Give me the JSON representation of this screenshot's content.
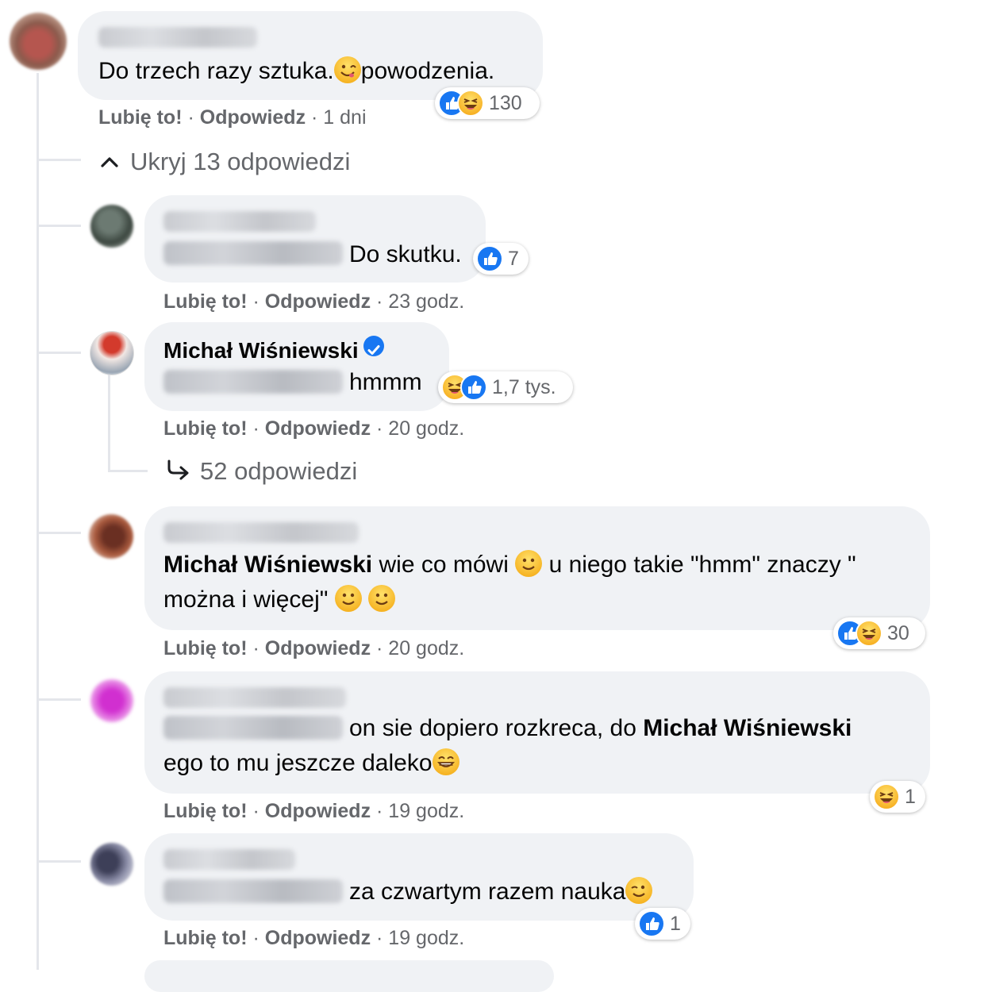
{
  "colors": {
    "link_blue": "#1877f2",
    "bubble_bg": "#f0f2f5",
    "meta_gray": "#65676b",
    "text": "#050505"
  },
  "comment_top": {
    "author": "Teresa Śpinak",
    "text": "Do trzech razy sztuka.",
    "emoji_1": "yum-emoji",
    "text_2": "powodzenia.",
    "like_label": "Lubię to!",
    "reply_label": "Odpowiedz",
    "time": "1 dni",
    "reactions": {
      "icons": [
        "like-icon",
        "haha-icon"
      ],
      "count": "130"
    }
  },
  "hide_replies": {
    "icon": "chevron-up-icon",
    "label": "Ukryj 13 odpowiedzi"
  },
  "replies": [
    {
      "author": "Alicja Lisowska",
      "mention": "Teresa Śpinak",
      "text": "Do skutku.",
      "like_label": "Lubię to!",
      "reply_label": "Odpowiedz",
      "time": "23 godz.",
      "reactions": {
        "icons": [
          "like-icon"
        ],
        "count": "7"
      }
    },
    {
      "author": "Michał Wiśniewski",
      "verified": true,
      "mention": "Teresa Śpinak",
      "text": "hmmm",
      "like_label": "Lubię to!",
      "reply_label": "Odpowiedz",
      "time": "20 godz.",
      "reactions": {
        "icons": [
          "haha-icon",
          "like-icon"
        ],
        "count": "1,7 tys."
      },
      "sub_replies": {
        "icon": "reply-arrow-icon",
        "label": "52 odpowiedzi"
      }
    },
    {
      "author": "Kamil Chmielewski",
      "mention_bold": "Michał Wiśniewski",
      "line1": "wie co mówi",
      "line1b": "u niego takie \"hmm\" znaczy \"",
      "line2": "można i więcej\"",
      "like_label": "Lubię to!",
      "reply_label": "Odpowiedz",
      "time": "20 godz.",
      "reactions": {
        "icons": [
          "like-icon",
          "haha-icon"
        ],
        "count": "30"
      }
    },
    {
      "author": "Patrycja Kowalczyk",
      "mention": "Teresa Śpinak",
      "line1": "on sie dopiero rozkreca, do",
      "mention_bold": "Michał Wiśniewski",
      "line2": "ego to mu jeszcze daleko",
      "like_label": "Lubię to!",
      "reply_label": "Odpowiedz",
      "time": "19 godz.",
      "reactions": {
        "icons": [
          "haha-icon"
        ],
        "count": "1"
      }
    },
    {
      "author": "Aneta Aneta",
      "mention": "Teresa Śpinak",
      "text": "za czwartym razem nauka",
      "like_label": "Lubię to!",
      "reply_label": "Odpowiedz",
      "time": "19 godz.",
      "reactions": {
        "icons": [
          "like-icon"
        ],
        "count": "1"
      }
    }
  ],
  "separator": " · "
}
